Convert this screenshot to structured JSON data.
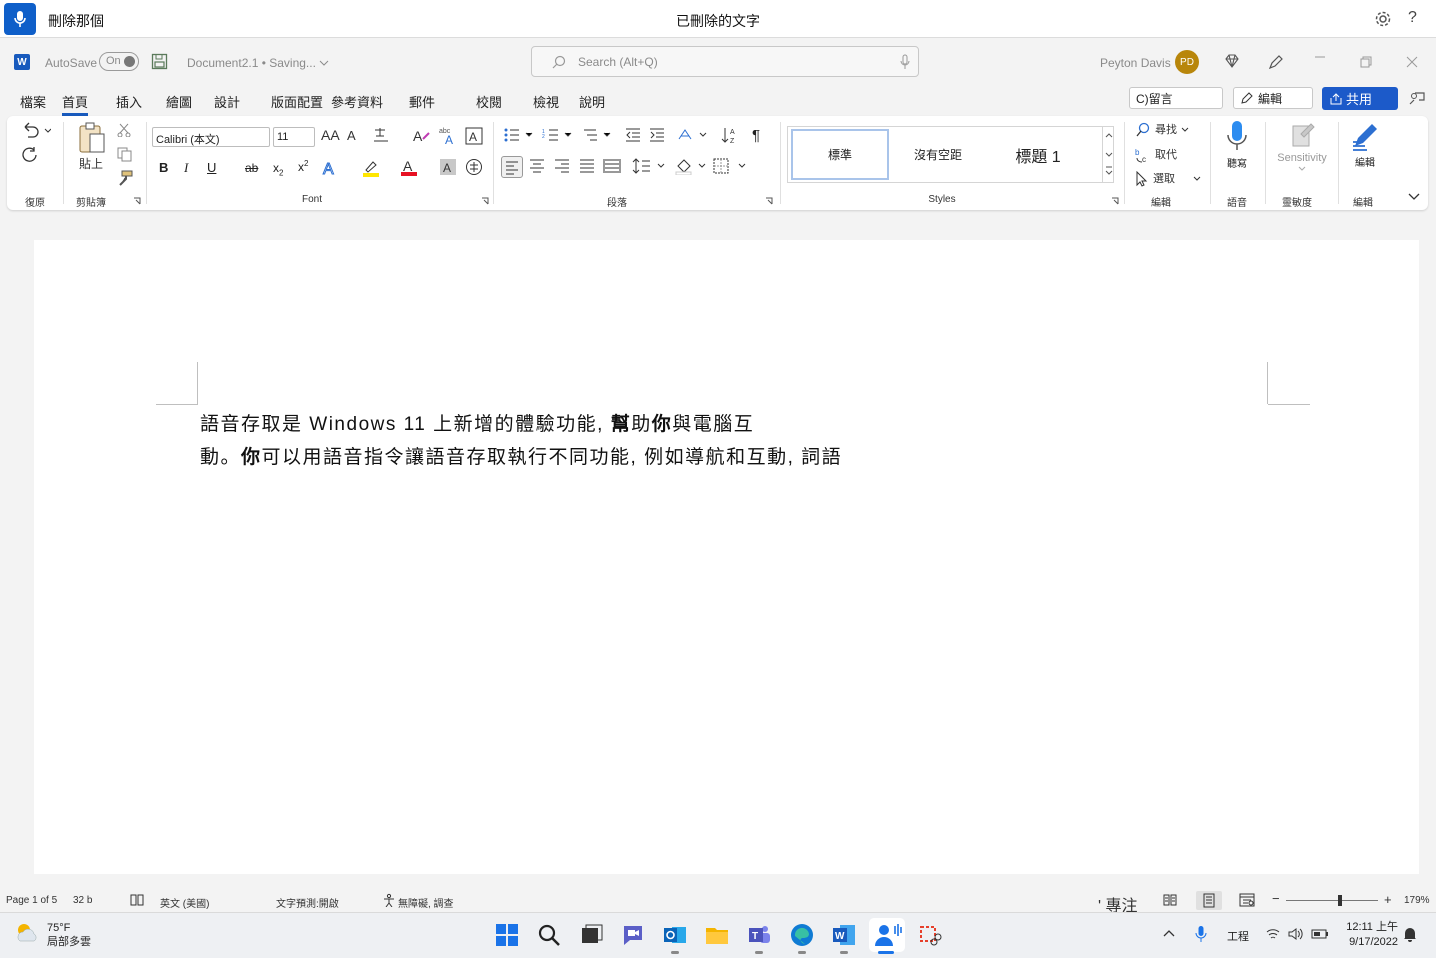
{
  "voice_bar": {
    "command": "刪除那個",
    "status": "已刪除的文字"
  },
  "title_bar": {
    "autosave_label": "AutoSave",
    "autosave_state": "On",
    "document_name": "Document2.1 • Saving...",
    "search_placeholder": "Search (Alt+Q)",
    "user_name": "Peyton Davis",
    "user_initials": "PD",
    "word_logo": "W"
  },
  "tabs": [
    "檔案",
    "首頁",
    "插入",
    "繪圖",
    "設計",
    "版面配置",
    "參考資料",
    "郵件",
    "校閱",
    "檢視",
    "說明"
  ],
  "active_tab": "首頁",
  "tab_right": {
    "comments": "C)留言",
    "editing": "編輯",
    "share": "共用"
  },
  "ribbon": {
    "undo_group": "復原",
    "paste_label": "貼上",
    "clipboard_group": "剪貼簿",
    "font_name": "Calibri (本文)",
    "font_size": "11",
    "font_group": "Font",
    "paragraph_group": "段落",
    "styles": [
      "標準",
      "沒有空距",
      "標題 1"
    ],
    "styles_group": "Styles",
    "find": "尋找",
    "replace": "取代",
    "select": "選取",
    "editing_group": "編輯",
    "dictate": "聽寫",
    "voice_group": "語音",
    "sensitivity": "Sensitivity",
    "sensitivity_group": "靈敏度",
    "editor": "編輯",
    "editor_group": "編輯"
  },
  "document": {
    "line1": {
      "p1": "語音存取是 Windows 11 上新增的體驗功能, ",
      "b1": "幫",
      "p2": "助",
      "b2": "你",
      "p3": "與電腦互"
    },
    "line2": {
      "p1": "動。",
      "b1": "你",
      "p2": "可以用語音指令讓語音存取執行不同功能, 例如導航和互動, 詞語"
    }
  },
  "status_bar": {
    "page": "Page 1 of 5",
    "words": "32 b",
    "language": "英文 (美國)",
    "prediction": "文字預測:開啟",
    "accessibility": "無障礙, 調查",
    "focus": "' 專注",
    "zoom": "179%"
  },
  "taskbar": {
    "weather_temp": "75°F",
    "weather_desc": "局部多雲",
    "work_label": "工程",
    "time": "12:11 上午",
    "date": "9/17/2022"
  }
}
